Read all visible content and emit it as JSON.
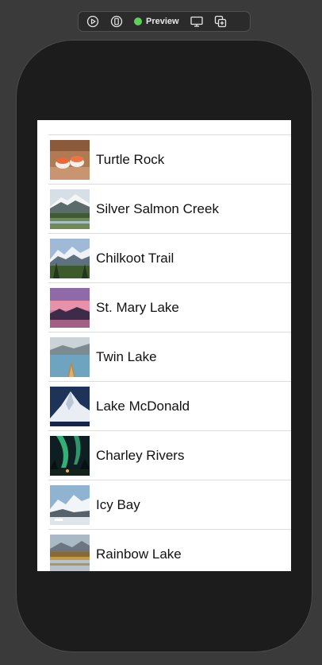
{
  "toolbar": {
    "play_icon": "play-circle-icon",
    "device_icon": "device-icon",
    "preview_label": "Preview",
    "preview_status_color": "#5fcf5b",
    "settings_icon": "monitor-settings-icon",
    "duplicate_icon": "duplicate-icon"
  },
  "landmarks": [
    {
      "name": "Turtle Rock",
      "thumbnail": "turtlerock"
    },
    {
      "name": "Silver Salmon Creek",
      "thumbnail": "silversalmoncreek"
    },
    {
      "name": "Chilkoot Trail",
      "thumbnail": "chilkoottrail"
    },
    {
      "name": "St. Mary Lake",
      "thumbnail": "stmarylake"
    },
    {
      "name": "Twin Lake",
      "thumbnail": "twinlake"
    },
    {
      "name": "Lake McDonald",
      "thumbnail": "lakemcdonald"
    },
    {
      "name": "Charley Rivers",
      "thumbnail": "charleyrivers"
    },
    {
      "name": "Icy Bay",
      "thumbnail": "icybay"
    },
    {
      "name": "Rainbow Lake",
      "thumbnail": "rainbowlake"
    }
  ]
}
